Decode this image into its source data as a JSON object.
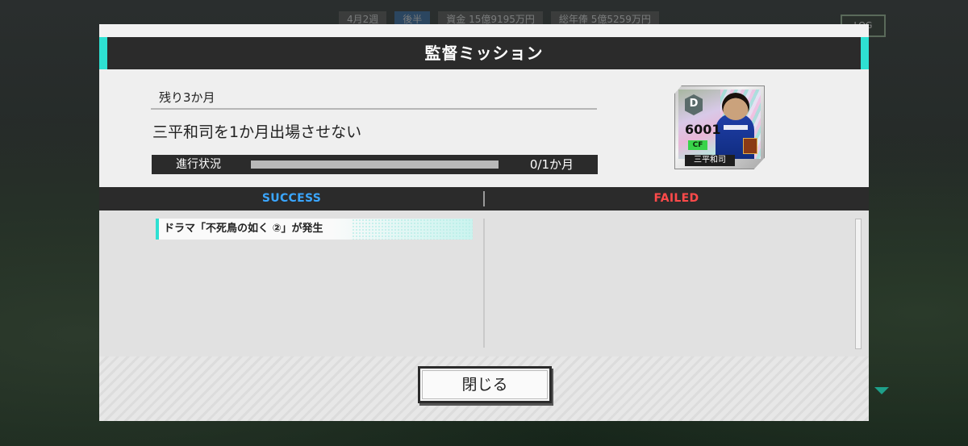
{
  "background": {
    "hud": [
      "4月2週",
      "後半",
      "資金 15億9195万円",
      "総年俸 5億5259万円"
    ],
    "log_button": "LOG"
  },
  "modal": {
    "title": "監督ミッション",
    "accent_color": "#2ee0d2",
    "mission": {
      "remaining": "残り3か月",
      "description": "三平和司を1か月出場させない",
      "progress_label": "進行状況",
      "progress_value": "0/1か月",
      "progress_fraction": 0.0
    },
    "player_card": {
      "rank": "D",
      "rating": "6001",
      "position": "CF",
      "name": "三平和司"
    },
    "results": {
      "success_header": "SUCCESS",
      "failed_header": "FAILED",
      "success_items": [
        "ドラマ「不死鳥の如く ②」が発生"
      ],
      "failed_items": []
    },
    "close_label": "閉じる"
  }
}
